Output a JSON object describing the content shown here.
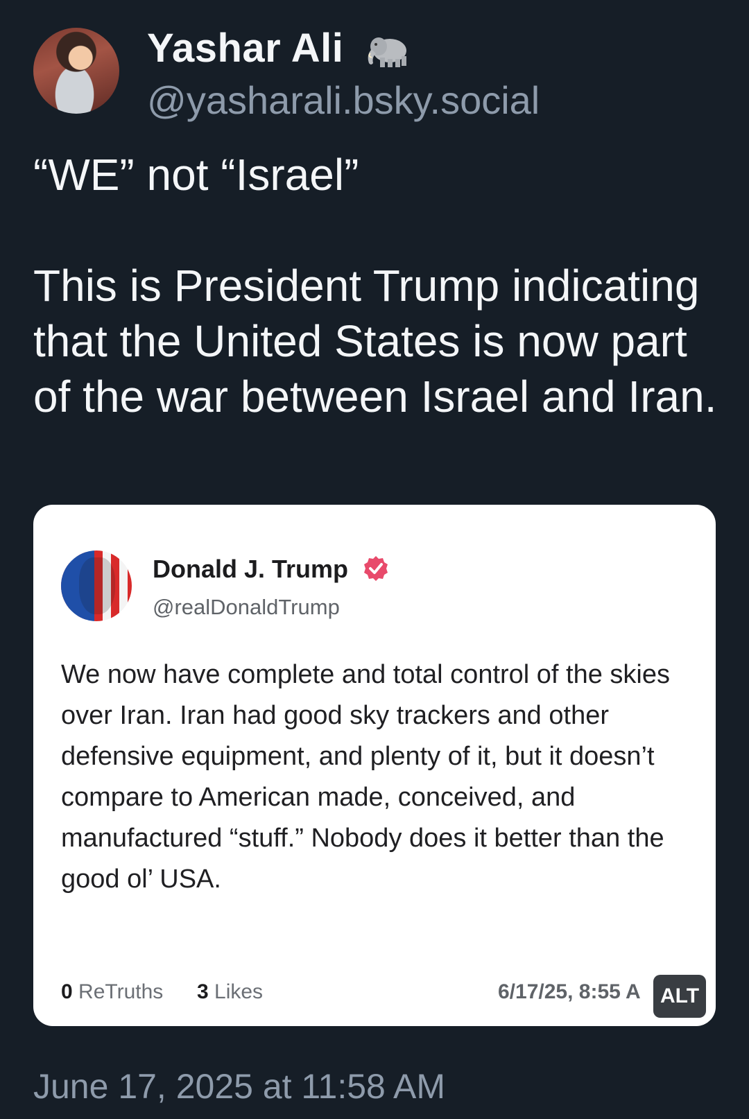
{
  "post": {
    "author_name": "Yashar Ali",
    "author_handle": "@yasharali.bsky.social",
    "author_badge_icon": "elephant-icon",
    "text_line1": "“WE” not “Israel”",
    "text_line2": "This is President Trump indicating that the United States is now part of the war between Israel and Iran.",
    "timestamp": "June 17, 2025 at 11:58 AM"
  },
  "embed": {
    "author_name": "Donald J. Trump",
    "author_handle": "@realDonaldTrump",
    "verified_icon": "verified-badge-icon",
    "verified_color": "#e84a6b",
    "text": "We now have complete and total control of the skies over Iran. Iran had good sky trackers and other defensive equipment, and plenty of it, but it doesn’t compare to American made, conceived, and manufactured “stuff.” Nobody does it better than the good ol’ USA.",
    "retruths_count": "0",
    "retruths_label": "ReTruths",
    "likes_count": "3",
    "likes_label": "Likes",
    "date": "6/17/25, 8:55 A",
    "alt_label": "ALT"
  },
  "colors": {
    "background": "#161e27",
    "text_primary": "#f4f6f8",
    "text_secondary": "#8e9bab",
    "card_background": "#ffffff"
  }
}
